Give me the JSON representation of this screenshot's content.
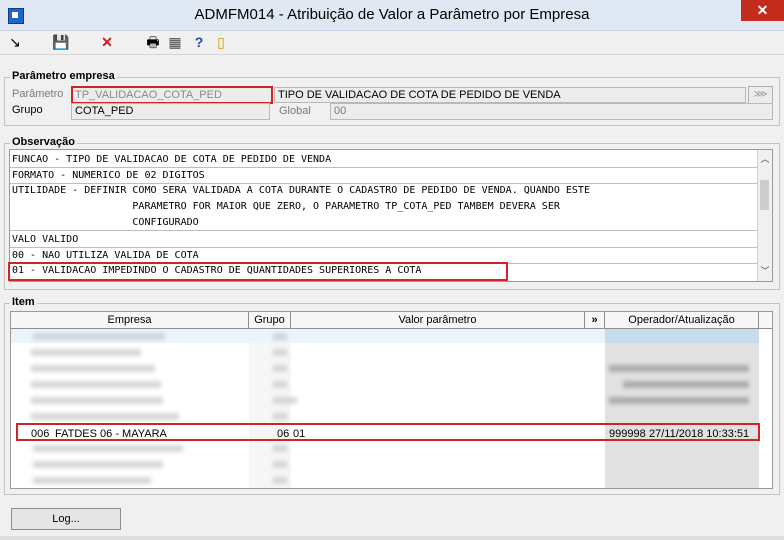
{
  "window": {
    "title": "ADMFM014 - Atribuição de Valor a Parâmetro por Empresa",
    "close_glyph": "✕"
  },
  "toolbar": {
    "items": [
      {
        "name": "exit-icon",
        "glyph": "↘"
      },
      {
        "name": "save-icon",
        "glyph": "💾"
      },
      {
        "name": "delete-icon",
        "glyph": "✕"
      },
      {
        "name": "print-icon",
        "glyph": "🖶"
      },
      {
        "name": "calculator-icon",
        "glyph": "▦"
      },
      {
        "name": "help-icon",
        "glyph": "?"
      },
      {
        "name": "door-icon",
        "glyph": "▯"
      }
    ]
  },
  "parametro_empresa": {
    "title": "Parâmetro empresa",
    "parametro_label": "Parâmetro",
    "parametro_value": "TP_VALIDACAO_COTA_PED",
    "descricao_value": "TIPO DE VALIDACAO DE COTA DE PEDIDO DE VENDA",
    "grupo_label": "Grupo",
    "grupo_value": "COTA_PED",
    "global_label": "Global",
    "global_value": "00",
    "lookup_glyph": "⋙"
  },
  "observacao": {
    "title": "Observação",
    "lines": [
      "FUNCAO - TIPO DE VALIDACAO DE COTA DE PEDIDO DE VENDA",
      "FORMATO - NUMERICO DE 02 DIGITOS",
      "UTILIDADE - DEFINIR COMO SERA VALIDADA A COTA DURANTE O CADASTRO DE PEDIDO DE VENDA. QUANDO ESTE",
      "                    PARAMETRO FOR MAIOR QUE ZERO, O PARAMETRO TP_COTA_PED TAMBEM DEVERA SER",
      "                    CONFIGURADO",
      "VALO VALIDO",
      "00 - NAO UTILIZA VALIDA DE COTA",
      "01 - VALIDACAO IMPEDINDO O CADASTRO DE QUANTIDADES SUPERIORES A COTA"
    ]
  },
  "item": {
    "title": "Item",
    "columns": [
      "Empresa",
      "Grupo",
      "Valor parâmetro",
      "»",
      "Operador/Atualização"
    ],
    "highlighted_row": {
      "empresa_code": "006",
      "empresa_name": "FATDES 06 - MAYARA",
      "grupo": "06",
      "valor": "01",
      "operador": "999998",
      "atualizacao": "27/11/2018 10:33:51"
    }
  },
  "footer": {
    "log_button": "Log..."
  }
}
